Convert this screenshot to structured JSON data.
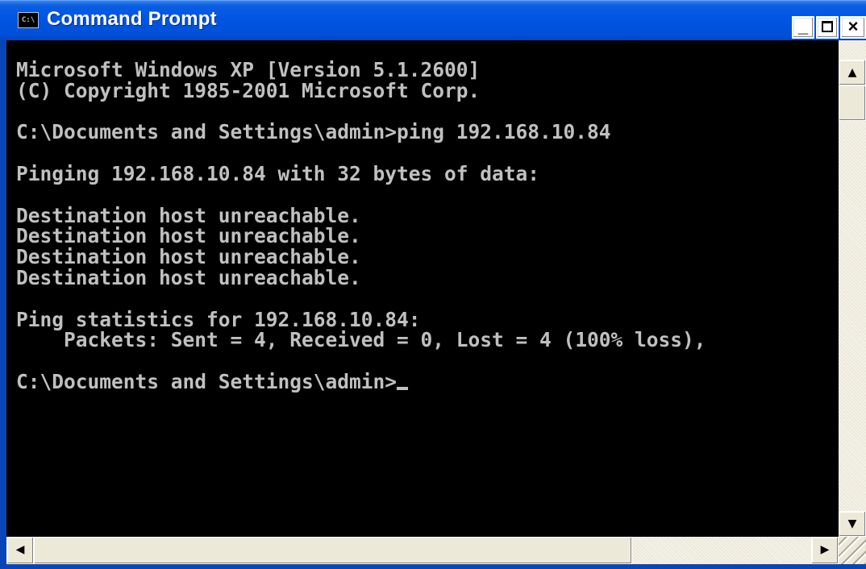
{
  "window": {
    "title": "Command Prompt",
    "icon_label": "C:\\",
    "icon": "console-icon",
    "controls": {
      "minimize_label": "_",
      "close_label": "×",
      "minimize_icon": "minimize-icon",
      "maximize_icon": "maximize-icon",
      "close_icon": "close-icon"
    }
  },
  "console": {
    "lines": [
      "Microsoft Windows XP [Version 5.1.2600]",
      "(C) Copyright 1985-2001 Microsoft Corp.",
      "",
      "C:\\Documents and Settings\\admin>ping 192.168.10.84",
      "",
      "Pinging 192.168.10.84 with 32 bytes of data:",
      "",
      "Destination host unreachable.",
      "Destination host unreachable.",
      "Destination host unreachable.",
      "Destination host unreachable.",
      "",
      "Ping statistics for 192.168.10.84:",
      "    Packets: Sent = 4, Received = 0, Lost = 4 (100% loss),",
      "",
      "C:\\Documents and Settings\\admin>"
    ]
  },
  "scrollbars": {
    "up_arrow": "▲",
    "down_arrow": "▼",
    "left_arrow": "◀",
    "right_arrow": "▶"
  },
  "colors": {
    "console_bg": "#000000",
    "console_fg": "#c0c0c0",
    "titlebar": "#0054e3"
  }
}
